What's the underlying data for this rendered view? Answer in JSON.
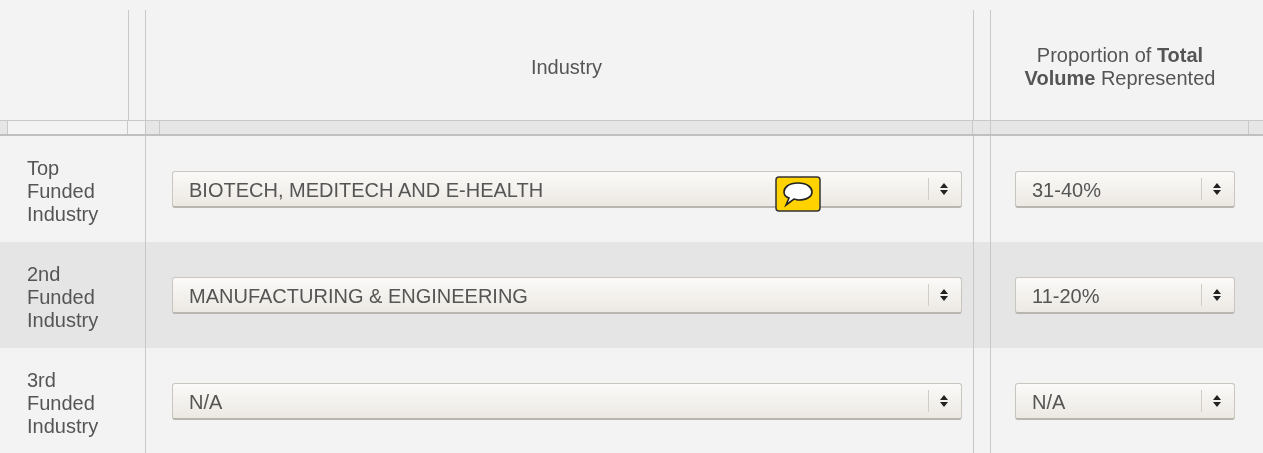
{
  "table": {
    "columns": [
      {
        "heading": "Industry"
      },
      {
        "heading": "Proportion of **Total Volume** Represented"
      }
    ],
    "rows": [
      {
        "label": "Top Funded Industry",
        "industry": "BIOTECH, MEDITECH AND E-HEALTH",
        "proportion": "31-40%",
        "comment": true,
        "shaded": false
      },
      {
        "label": "2nd Funded Industry",
        "industry": "MANUFACTURING & ENGINEERING",
        "proportion": "11-20%",
        "comment": false,
        "shaded": true
      },
      {
        "label": "3rd Funded Industry",
        "industry": "N/A",
        "proportion": "N/A",
        "comment": false,
        "shaded": false
      }
    ]
  }
}
